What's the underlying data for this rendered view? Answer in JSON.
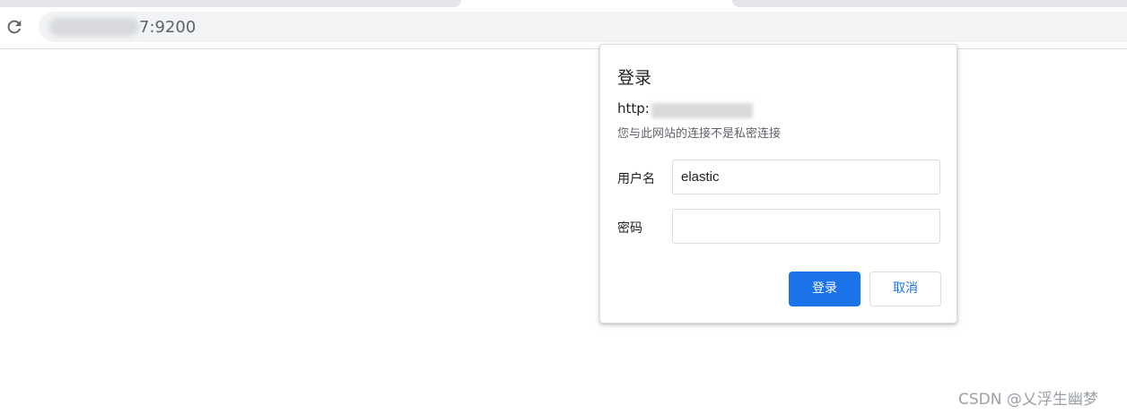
{
  "browser": {
    "url_visible_suffix": "7:9200",
    "reload_icon": "reload-icon"
  },
  "dialog": {
    "title": "登录",
    "origin_prefix": "http:",
    "subtitle": "您与此网站的连接不是私密连接",
    "username_label": "用户名",
    "username_value": "elastic",
    "password_label": "密码",
    "password_value": "",
    "login_button": "登录",
    "cancel_button": "取消"
  },
  "colors": {
    "primary": "#1a73e8",
    "border": "#dadce0",
    "muted_text": "#5f6368"
  },
  "watermark": "CSDN @乂浮生幽梦"
}
